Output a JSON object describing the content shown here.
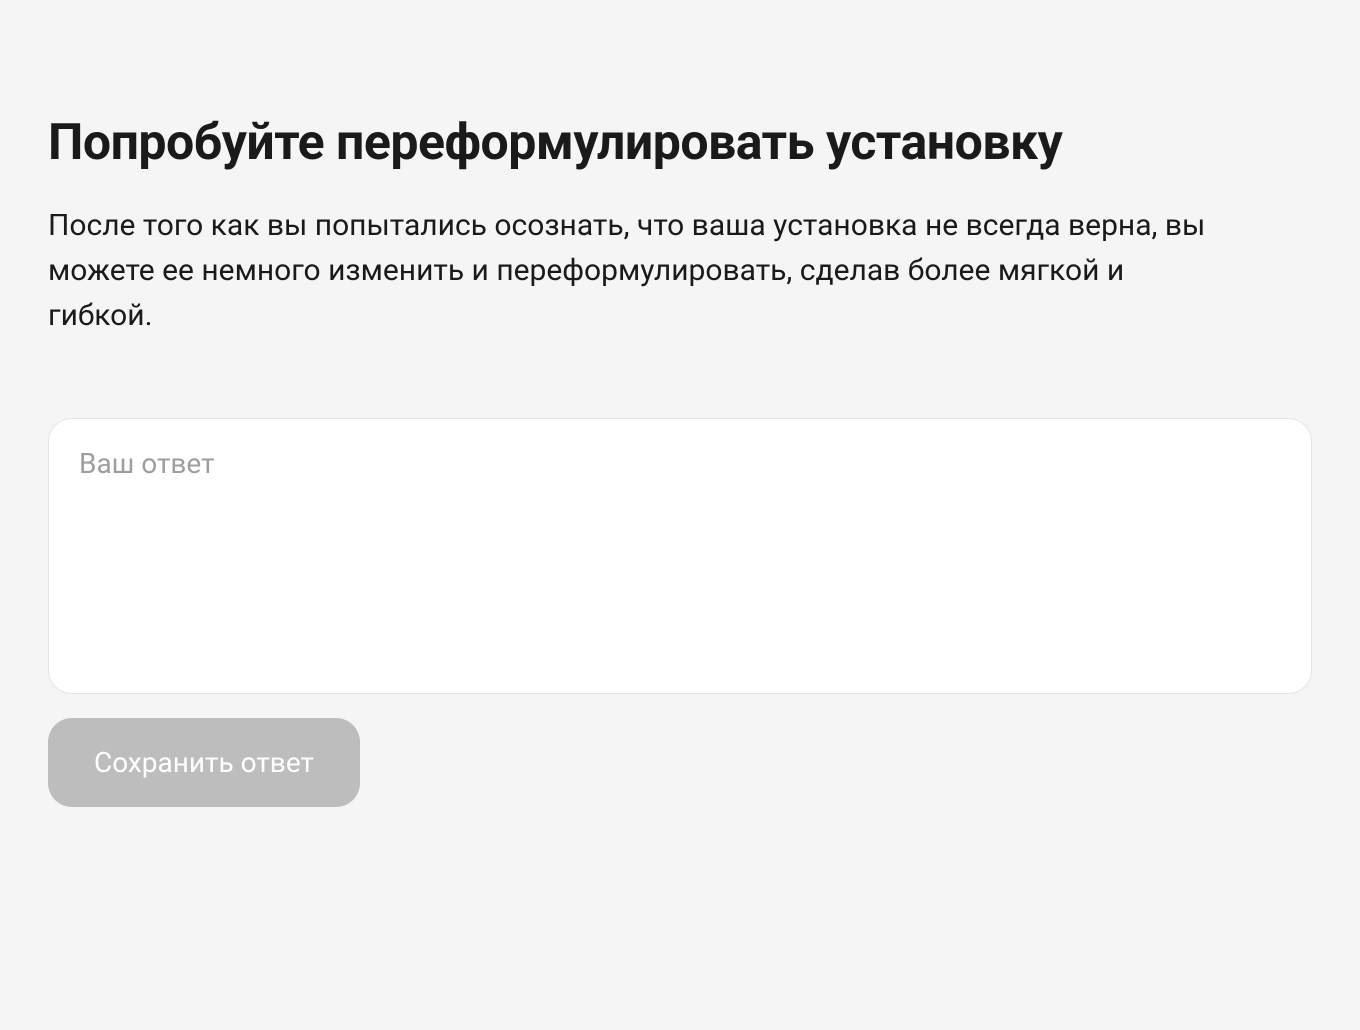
{
  "heading": "Попробуйте переформулировать установку",
  "description": "После того как вы попытались осознать, что ваша установка не всегда верна, вы можете ее немного изменить и переформулировать, сделав более мягкой и гибкой.",
  "form": {
    "textarea_placeholder": "Ваш ответ",
    "textarea_value": "",
    "save_button_label": "Сохранить ответ"
  }
}
